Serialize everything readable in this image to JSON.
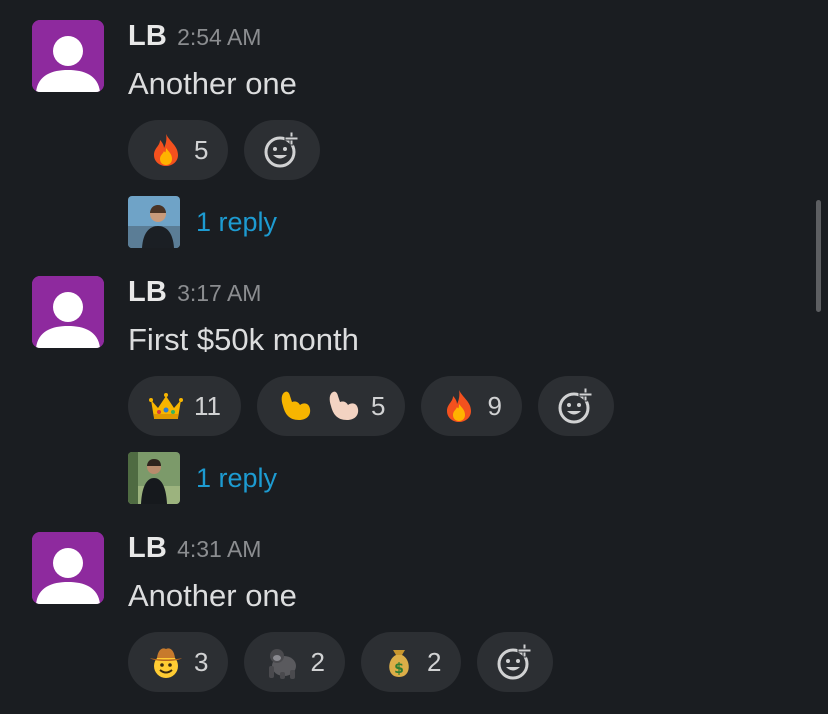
{
  "messages": [
    {
      "author": "LB",
      "time": "2:54 AM",
      "text": "Another one",
      "reactions": [
        {
          "emoji": "fire",
          "count": "5"
        }
      ],
      "thread": {
        "reply_text": "1 reply"
      }
    },
    {
      "author": "LB",
      "time": "3:17 AM",
      "text": "First $50k month",
      "reactions": [
        {
          "emoji": "crown",
          "count": "11"
        },
        {
          "emoji": "flexed-biceps-pair",
          "count": "5"
        },
        {
          "emoji": "fire",
          "count": "9"
        }
      ],
      "thread": {
        "reply_text": "1 reply"
      }
    },
    {
      "author": "LB",
      "time": "4:31 AM",
      "text": "Another one",
      "reactions": [
        {
          "emoji": "cowboy-face",
          "count": "3"
        },
        {
          "emoji": "gorilla",
          "count": "2"
        },
        {
          "emoji": "money-bag",
          "count": "2"
        }
      ]
    }
  ],
  "colors": {
    "background": "#1a1d21",
    "avatar": "#8e2a9e",
    "link": "#1d9bd1",
    "reaction_bg": "#2c2f33"
  }
}
